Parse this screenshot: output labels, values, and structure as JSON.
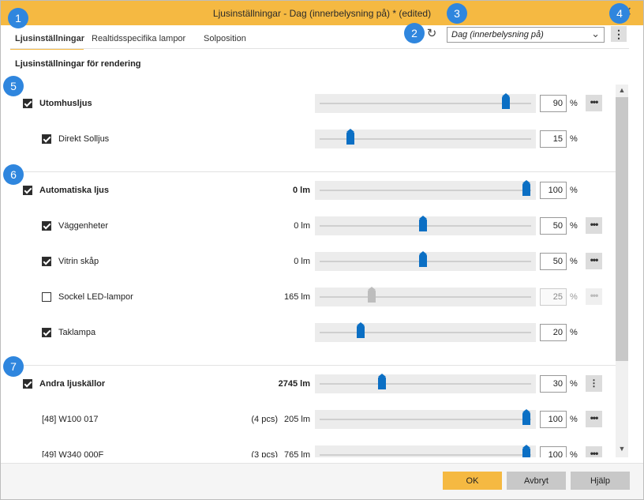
{
  "window": {
    "title": "Ljusinställningar - Dag (innerbelysning på) * (edited)",
    "close_glyph": "✕"
  },
  "tabs": [
    {
      "label": "Ljusinställningar"
    },
    {
      "label": "Realtidsspecifika lampor"
    },
    {
      "label": "Solposition"
    }
  ],
  "toolbar": {
    "reset_glyph": "↻",
    "preset_value": "Dag (innerbelysning på)",
    "chevron_glyph": "⌄",
    "more_glyph": "⋮"
  },
  "section_label": "Ljusinställningar för rendering",
  "groups": {
    "outdoor": {
      "label": "Utomhusljus",
      "checked": true,
      "lm": "",
      "value": "90",
      "level": 0.9,
      "children": [
        {
          "label": "Direkt Solljus",
          "checked": true,
          "lm": "",
          "value": "15",
          "level": 0.15
        }
      ]
    },
    "automatic": {
      "label": "Automatiska ljus",
      "checked": true,
      "lm": "0 lm",
      "value": "100",
      "level": 1.0,
      "children": [
        {
          "label": "Väggenheter",
          "checked": true,
          "lm": "0 lm",
          "value": "50",
          "level": 0.5
        },
        {
          "label": "Vitrin skåp",
          "checked": true,
          "lm": "0 lm",
          "value": "50",
          "level": 0.5
        },
        {
          "label": "Sockel LED-lampor",
          "checked": false,
          "lm": "165 lm",
          "value": "25",
          "level": 0.25
        },
        {
          "label": "Taklampa",
          "checked": true,
          "lm": "",
          "value": "20",
          "level": 0.2
        }
      ]
    },
    "other": {
      "label": "Andra ljuskällor",
      "checked": true,
      "lm": "2745 lm",
      "value": "30",
      "level": 0.3,
      "children": [
        {
          "label": "[48] W100 017",
          "pcs": "(4 pcs)",
          "lm": "205 lm",
          "value": "100",
          "level": 1.0
        },
        {
          "label": "[49] W340 000F",
          "pcs": "(3 pcs)",
          "lm": "765 lm",
          "value": "100",
          "level": 1.0
        }
      ]
    }
  },
  "percent_sign": "%",
  "more_glyph": "•••",
  "scroll": {
    "up": "▲",
    "down": "▼"
  },
  "footer": {
    "ok": "OK",
    "cancel": "Avbryt",
    "help": "Hjälp"
  },
  "markers": [
    "1",
    "2",
    "3",
    "4",
    "5",
    "6",
    "7"
  ],
  "colors": {
    "accent": "#f5b942",
    "slider_thumb": "#0b6fc4",
    "marker": "#2f86de"
  }
}
